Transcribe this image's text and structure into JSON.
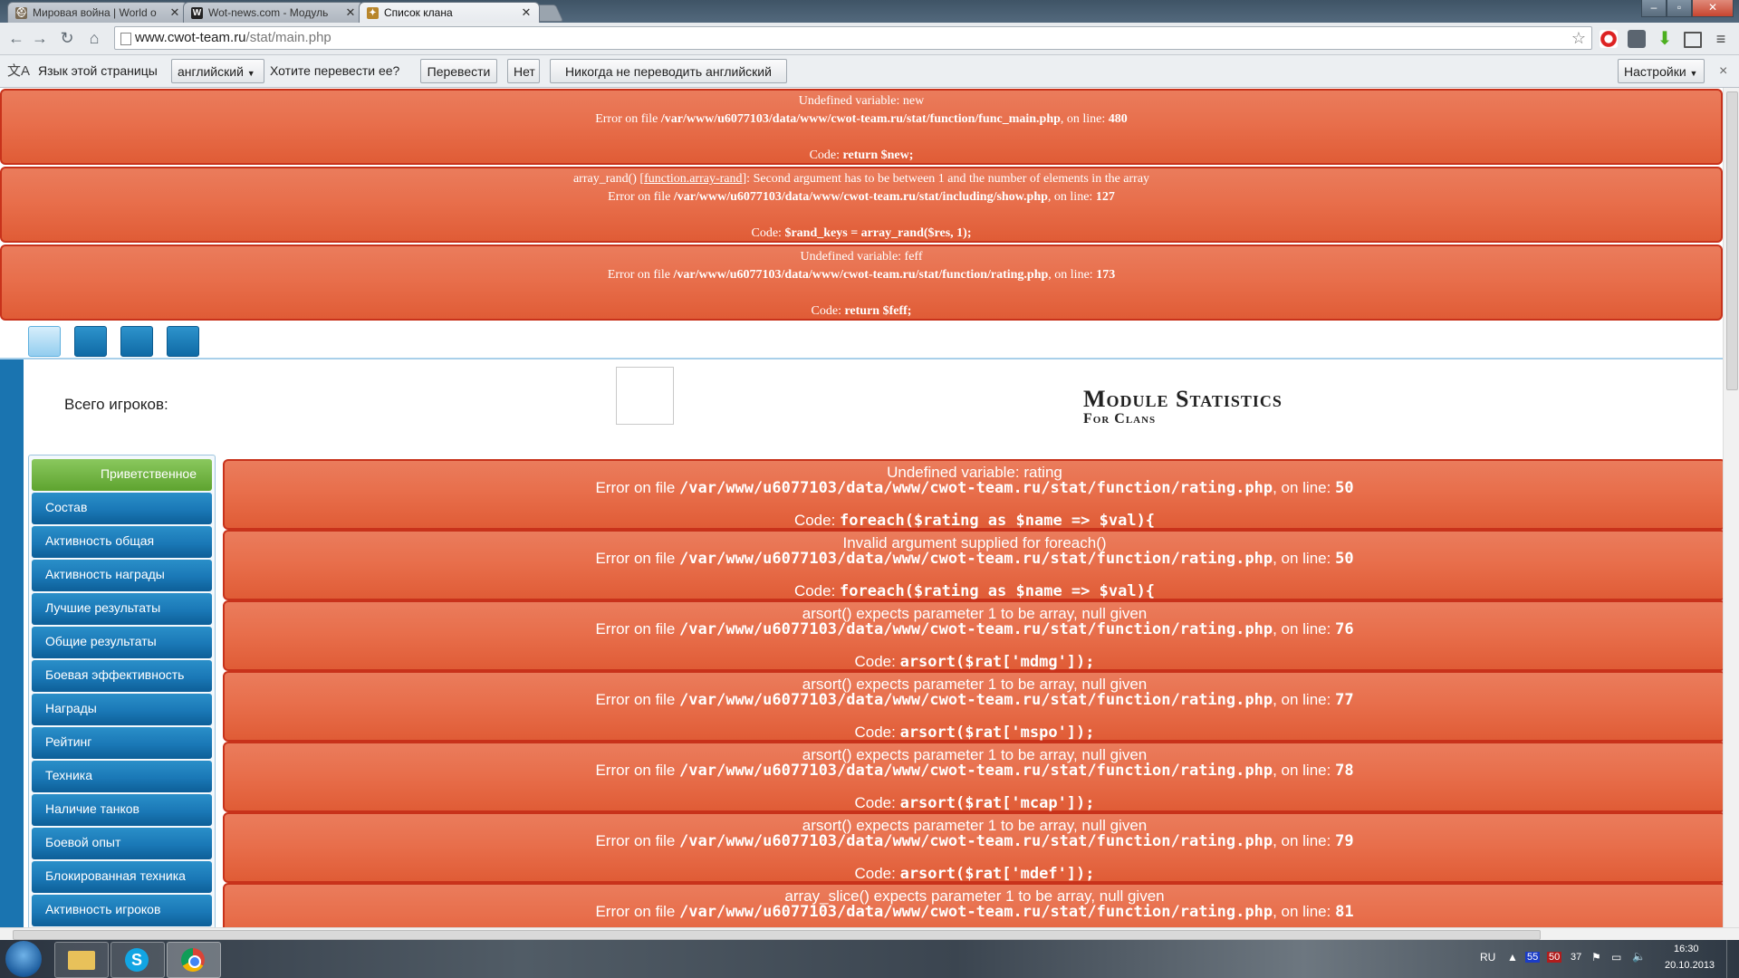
{
  "tabs": [
    {
      "title": "Мировая война | World o",
      "favicon": "helmet-icon"
    },
    {
      "title": "Wot-news.com - Модуль",
      "favicon": "w-icon"
    },
    {
      "title": "Список клана",
      "favicon": "clan-emblem-icon"
    }
  ],
  "address": {
    "host": "www.cwot-team.ru",
    "path": "/stat/main.php"
  },
  "translate": {
    "label": "Язык этой страницы",
    "language": "английский",
    "question": "Хотите перевести ее?",
    "translate_btn": "Перевести",
    "no_btn": "Нет",
    "never_btn": "Никогда не переводить английский",
    "settings_btn": "Настройки",
    "close": "×"
  },
  "top_errors": [
    {
      "message": "Undefined variable: new",
      "prefix": "Error on file",
      "file": "/var/www/u6077103/data/www/cwot-team.ru/stat/function/func_main.php",
      "mid": ", on line:",
      "line": "480",
      "code_label": "Code:",
      "code": "return $new;"
    },
    {
      "message_pre": "array_rand() [",
      "link": "function.array-rand",
      "message_post": "]: Second argument has to be between 1 and the number of elements in the array",
      "prefix": "Error on file",
      "file": "/var/www/u6077103/data/www/cwot-team.ru/stat/including/show.php",
      "mid": ", on line:",
      "line": "127",
      "code_label": "Code:",
      "code": "$rand_keys = array_rand($res, 1);"
    },
    {
      "message": "Undefined variable: feff",
      "prefix": "Error on file",
      "file": "/var/www/u6077103/data/www/cwot-team.ru/stat/function/rating.php",
      "mid": ", on line:",
      "line": "173",
      "code_label": "Code:",
      "code": "return $feff;"
    }
  ],
  "header": {
    "players_label": "Всего игроков:",
    "logo_line1": "Module Statistics",
    "logo_line2": "For Clans"
  },
  "menu": [
    "Приветственное",
    "Состав",
    "Активность общая",
    "Активность награды",
    "Лучшие результаты",
    "Общие результаты",
    "Боевая эффективность",
    "Награды",
    "Рейтинг",
    "Техника",
    "Наличие танков",
    "Боевой опыт",
    "Блокированная техника",
    "Активность игроков"
  ],
  "main_errors": [
    {
      "message": "Undefined variable: rating",
      "prefix": "Error on file",
      "file": "/var/www/u6077103/data/www/cwot-team.ru/stat/function/rating.php",
      "mid": ", on line:",
      "line": "50",
      "code_label": "Code:",
      "code": "foreach($rating as $name => $val){"
    },
    {
      "message": "Invalid argument supplied for foreach()",
      "prefix": "Error on file",
      "file": "/var/www/u6077103/data/www/cwot-team.ru/stat/function/rating.php",
      "mid": ", on line:",
      "line": "50",
      "code_label": "Code:",
      "code": "foreach($rating as $name => $val){"
    },
    {
      "message": "arsort() expects parameter 1 to be array, null given",
      "prefix": "Error on file",
      "file": "/var/www/u6077103/data/www/cwot-team.ru/stat/function/rating.php",
      "mid": ", on line:",
      "line": "76",
      "code_label": "Code:",
      "code": "arsort($rat['mdmg']);"
    },
    {
      "message": "arsort() expects parameter 1 to be array, null given",
      "prefix": "Error on file",
      "file": "/var/www/u6077103/data/www/cwot-team.ru/stat/function/rating.php",
      "mid": ", on line:",
      "line": "77",
      "code_label": "Code:",
      "code": "arsort($rat['mspo']);"
    },
    {
      "message": "arsort() expects parameter 1 to be array, null given",
      "prefix": "Error on file",
      "file": "/var/www/u6077103/data/www/cwot-team.ru/stat/function/rating.php",
      "mid": ", on line:",
      "line": "78",
      "code_label": "Code:",
      "code": "arsort($rat['mcap']);"
    },
    {
      "message": "arsort() expects parameter 1 to be array, null given",
      "prefix": "Error on file",
      "file": "/var/www/u6077103/data/www/cwot-team.ru/stat/function/rating.php",
      "mid": ", on line:",
      "line": "79",
      "code_label": "Code:",
      "code": "arsort($rat['mdef']);"
    },
    {
      "message": "array_slice() expects parameter 1 to be array, null given",
      "prefix": "Error on file",
      "file": "/var/www/u6077103/data/www/cwot-team.ru/stat/function/rating.php",
      "mid": ", on line:",
      "line": "81",
      "code_label": "",
      "code": ""
    }
  ],
  "taskbar": {
    "lang": "RU",
    "badge1": "55",
    "badge2": "50",
    "badge3": "37",
    "time": "16:30",
    "date": "20.10.2013"
  },
  "colors": {
    "error_bg": "#e86f4c",
    "error_border": "#c8321b",
    "menu_blue": "#1a78b6",
    "menu_active": "#6aaf3b"
  }
}
